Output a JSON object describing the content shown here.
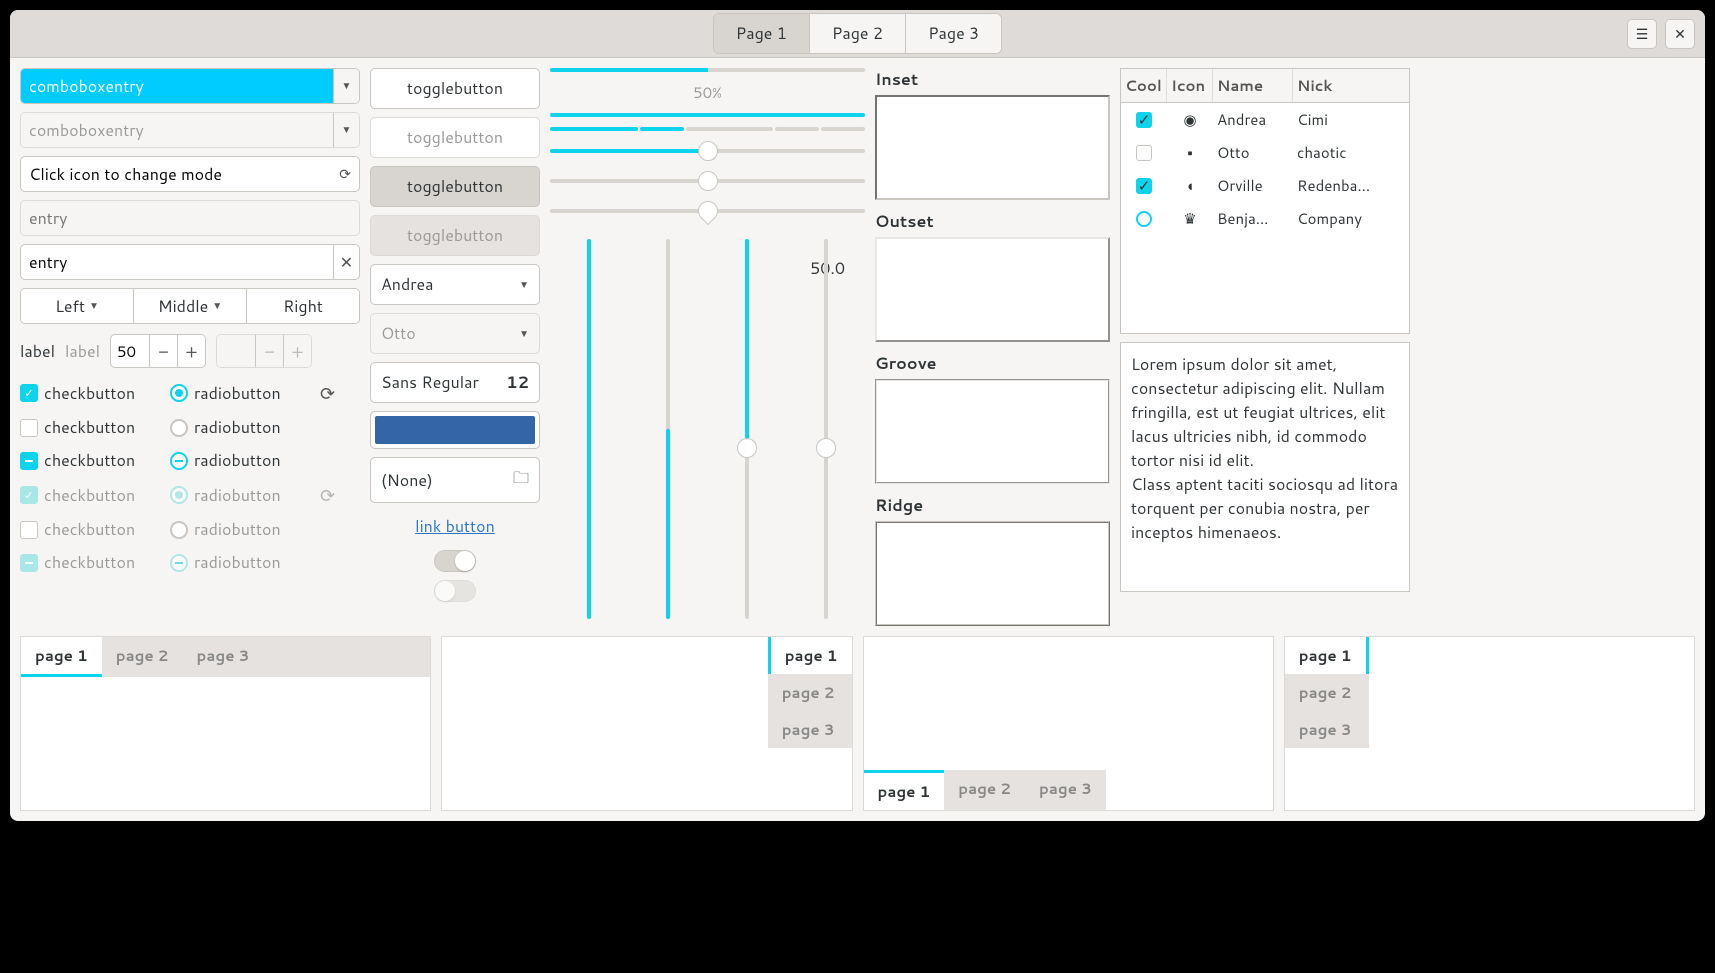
{
  "titlebar": {
    "tabs": [
      "Page 1",
      "Page 2",
      "Page 3"
    ],
    "active": 0
  },
  "col1": {
    "combo1": "comboboxentry",
    "combo2": "comboboxentry",
    "iconmode": "Click icon to change mode",
    "entry1": "entry",
    "entry2": "entry",
    "linked": [
      "Left",
      "Middle",
      "Right"
    ],
    "labels": {
      "lbl": "label",
      "lbl_dis": "label",
      "spin": "50"
    },
    "check_label": "checkbutton",
    "radio_label": "radiobutton"
  },
  "col2": {
    "toggles": [
      "togglebutton",
      "togglebutton",
      "togglebutton",
      "togglebutton"
    ],
    "sel1": "Andrea",
    "sel2": "Otto",
    "font": {
      "name": "Sans Regular",
      "size": "12"
    },
    "file": "(None)",
    "link": "link button"
  },
  "col3": {
    "progress_label": "50%",
    "vscale_val": "50.0"
  },
  "col4": {
    "frames": [
      "Inset",
      "Outset",
      "Groove",
      "Ridge"
    ]
  },
  "table": {
    "headers": [
      "Cool",
      "Icon",
      "Name",
      "Nick"
    ],
    "rows": [
      {
        "cool": true,
        "icon": "◉",
        "name": "Andrea",
        "nick": "Cimi"
      },
      {
        "cool": false,
        "icon": "▪",
        "name": "Otto",
        "nick": "chaotic"
      },
      {
        "cool": true,
        "icon": "◖",
        "name": "Orville",
        "nick": "Redenba..."
      },
      {
        "cool": "radio",
        "icon": "♛",
        "name": "Benja...",
        "nick": "Company"
      }
    ]
  },
  "textview": "Lorem ipsum dolor sit amet, consectetur adipiscing elit. Nullam fringilla, est ut feugiat ultrices, elit lacus ultricies nibh, id commodo tortor nisi id elit.\nClass aptent taciti sociosqu ad litora torquent per conubia nostra, per inceptos himenaeos.",
  "notebooks": {
    "tabs": [
      "page 1",
      "page 2",
      "page 3"
    ]
  }
}
